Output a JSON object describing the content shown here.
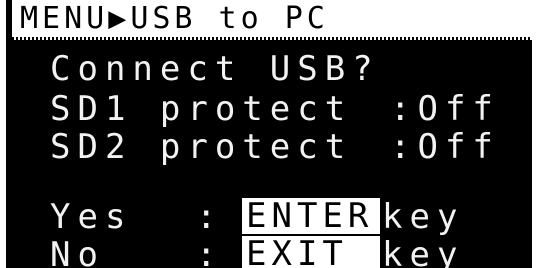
{
  "header": {
    "breadcrumb_root": "MENU",
    "separator_icon": "play-arrow-icon",
    "separator_glyph": "▶",
    "breadcrumb_page": "USB to PC"
  },
  "body": {
    "question": "Connect USB?",
    "settings": [
      {
        "label": "SD1 protect",
        "value": ":Off"
      },
      {
        "label": "SD2 protect",
        "value": ":Off"
      }
    ],
    "actions": [
      {
        "label": "Yes",
        "colon": ":",
        "key": "ENTER",
        "suffix": "key"
      },
      {
        "label": "No",
        "colon": ":",
        "key": "EXIT",
        "suffix": "key"
      }
    ]
  },
  "colors": {
    "screen_background": "#000000",
    "text": "#f2f2f2",
    "highlight_background": "#ffffff",
    "highlight_text": "#000000"
  }
}
